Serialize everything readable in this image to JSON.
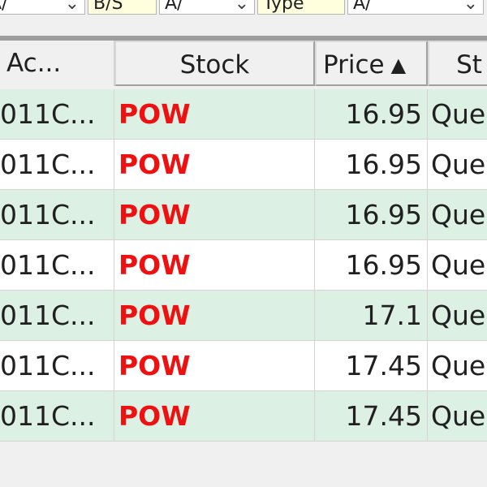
{
  "filter_bar": {
    "items": [
      {
        "text": "A/",
        "chevron": "⌄",
        "style": "white"
      },
      {
        "text": "B/S",
        "chevron": "",
        "style": "yellow"
      },
      {
        "text": "A/",
        "chevron": "⌄",
        "style": "white"
      },
      {
        "text": "Type",
        "chevron": "",
        "style": "yellow"
      },
      {
        "text": "A/",
        "chevron": "⌄",
        "style": "white"
      }
    ]
  },
  "table": {
    "columns": [
      {
        "key": "account",
        "label": "Ac..."
      },
      {
        "key": "stock",
        "label": "Stock"
      },
      {
        "key": "price",
        "label": "Price",
        "sort": "ascending"
      },
      {
        "key": "status",
        "label": "St"
      }
    ],
    "sort_icon": "▲",
    "rows": [
      {
        "account": "011C...",
        "stock": "POW",
        "price": "16.95",
        "status": "Que"
      },
      {
        "account": "011C...",
        "stock": "POW",
        "price": "16.95",
        "status": "Que"
      },
      {
        "account": "011C...",
        "stock": "POW",
        "price": "16.95",
        "status": "Que"
      },
      {
        "account": "011C...",
        "stock": "POW",
        "price": "16.95",
        "status": "Que"
      },
      {
        "account": "011C...",
        "stock": "POW",
        "price": "17.1",
        "status": "Que"
      },
      {
        "account": "011C...",
        "stock": "POW",
        "price": "17.45",
        "status": "Que"
      },
      {
        "account": "011C...",
        "stock": "POW",
        "price": "17.45",
        "status": "Que"
      }
    ]
  },
  "colors": {
    "row_alt": "#dcf0e4",
    "row_plain": "#ffffff",
    "stock_text": "#ee1111",
    "header_bg": "#f0f0f0"
  }
}
